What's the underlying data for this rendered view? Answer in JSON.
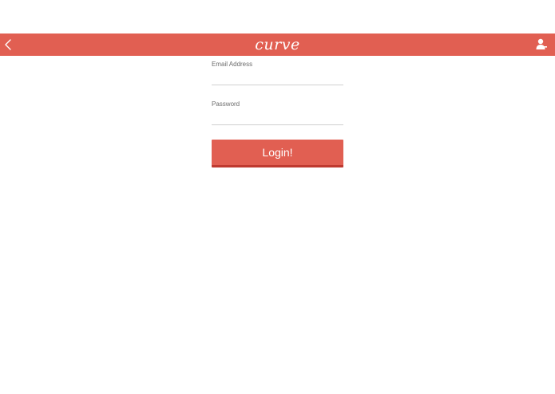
{
  "header": {
    "brand": "curve",
    "back_icon": "chevron-left-icon",
    "profile_icon": "user-icon",
    "accent_color": "#e15f52"
  },
  "form": {
    "email_label": "Email Address",
    "email_value": "",
    "password_label": "Password",
    "password_value": "",
    "submit_label": "Login!"
  }
}
